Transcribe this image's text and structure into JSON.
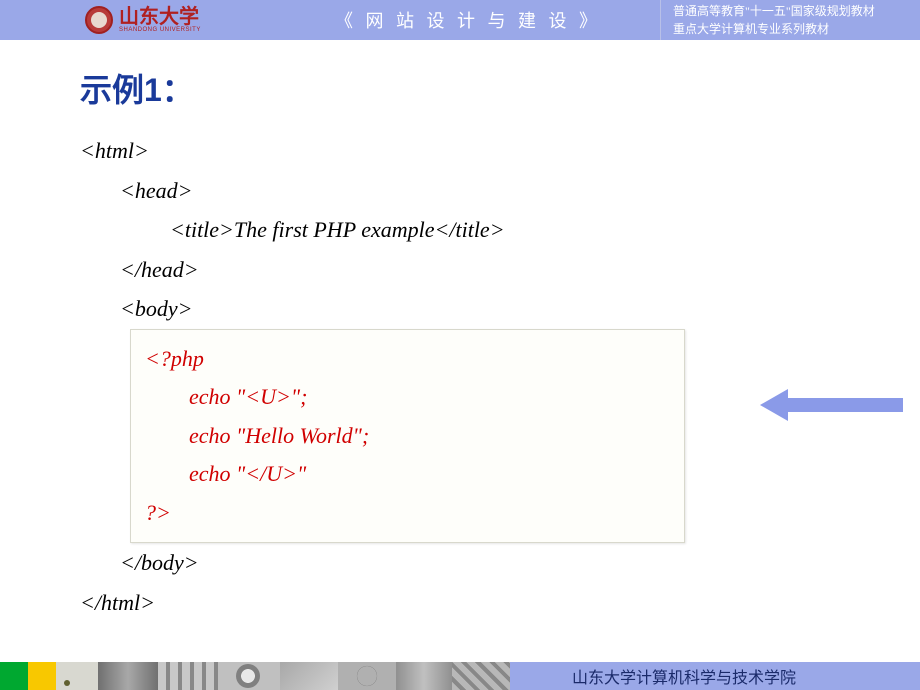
{
  "header": {
    "university_name": "山东大学",
    "university_sub": "SHANDONG UNIVERSITY",
    "course_title": "《 网 站 设 计 与 建 设 》",
    "series_line1": "普通高等教育\"十一五\"国家级规划教材",
    "series_line2": "重点大学计算机专业系列教材"
  },
  "content": {
    "example_title": "示例1：",
    "code": {
      "l1": "<html>",
      "l2": "<head>",
      "l3": "<title>The first PHP example</title>",
      "l4": "</head>",
      "l5": "<body>",
      "php": {
        "p1": "<?php",
        "p2": "        echo \"<U>\";",
        "p3": "        echo \"Hello World\";",
        "p4": "        echo \"</U>\"",
        "p5": "?>"
      },
      "l6": "</body>",
      "l7": "</html>"
    }
  },
  "footer": {
    "institution": "山东大学计算机科学与技术学院"
  }
}
